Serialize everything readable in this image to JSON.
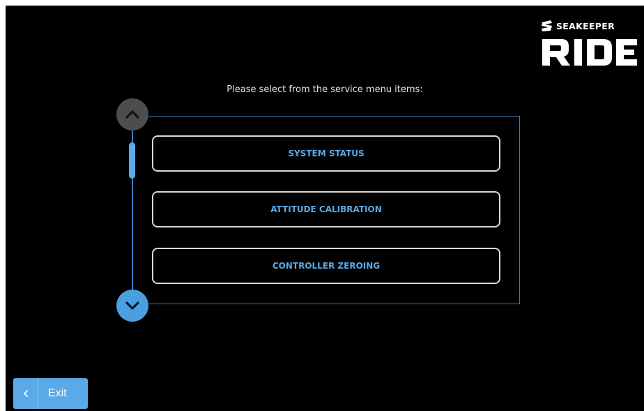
{
  "brand": {
    "company": "SEAKEEPER",
    "product": "RIDE"
  },
  "prompt": "Please select from the service menu items:",
  "menu": {
    "items": [
      {
        "label": "SYSTEM STATUS"
      },
      {
        "label": "ATTITUDE CALIBRATION"
      },
      {
        "label": "CONTROLLER ZEROING"
      }
    ],
    "scroll_up_icon": "chevron-up-icon",
    "scroll_down_icon": "chevron-down-icon"
  },
  "footer": {
    "exit_label": "Exit",
    "exit_icon": "chevron-left-icon"
  },
  "colors": {
    "background": "#000000",
    "accent": "#5aaae8",
    "item_text": "#5aa9e6",
    "item_border": "#d9d9d9",
    "panel_border": "#3a79b6",
    "disabled_scroll": "#4d4d4d"
  }
}
